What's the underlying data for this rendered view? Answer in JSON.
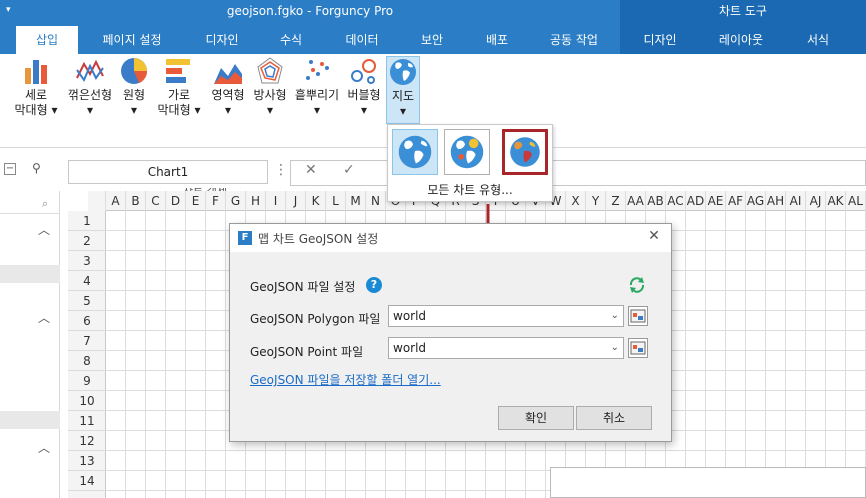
{
  "window": {
    "title": "geojson.fgko - Forguncy Pro",
    "context_title": "차트 도구"
  },
  "tabs": [
    {
      "label": "삽입",
      "active": true
    },
    {
      "label": "페이지 설정"
    },
    {
      "label": "디자인"
    },
    {
      "label": "수식"
    },
    {
      "label": "데이터"
    },
    {
      "label": "보안"
    },
    {
      "label": "배포"
    },
    {
      "label": "공동 작업"
    },
    {
      "label": "디자인"
    },
    {
      "label": "레이아웃"
    },
    {
      "label": "서식"
    }
  ],
  "ribbon": {
    "buttons": [
      {
        "line1": "세로",
        "line2": "막대형 ▾"
      },
      {
        "line1": "꺾은선형",
        "line2": "▾"
      },
      {
        "line1": "원형",
        "line2": "▾"
      },
      {
        "line1": "가로",
        "line2": "막대형 ▾"
      },
      {
        "line1": "영역형",
        "line2": "▾"
      },
      {
        "line1": "방사형",
        "line2": "▾"
      },
      {
        "line1": "흩뿌리기",
        "line2": "▾"
      },
      {
        "line1": "버블형",
        "line2": "▾"
      },
      {
        "line1": "지도",
        "line2": "▾"
      }
    ],
    "group_label": "차트 객체"
  },
  "formula_bar": {
    "name_box": "Chart1"
  },
  "columns": [
    "A",
    "B",
    "C",
    "D",
    "E",
    "F",
    "G",
    "H",
    "I",
    "J",
    "K",
    "L",
    "M",
    "N",
    "O",
    "P",
    "Q",
    "R",
    "S",
    "T",
    "U",
    "V",
    "W",
    "X",
    "Y",
    "Z",
    "AA",
    "AB",
    "AC",
    "AD",
    "AE",
    "AF",
    "AG",
    "AH",
    "AI",
    "AJ",
    "AK",
    "AL"
  ],
  "rows": [
    "1",
    "2",
    "3",
    "4",
    "5",
    "6",
    "7",
    "8",
    "9",
    "10",
    "11",
    "12",
    "13",
    "14"
  ],
  "dropdown": {
    "all_types": "모든 차트 유형..."
  },
  "dialog": {
    "title": "맵 차트 GeoJSON 설정",
    "header_label": "GeoJSON 파일 설정",
    "polygon_label": "GeoJSON Polygon 파일",
    "polygon_value": "world",
    "point_label": "GeoJSON Point 파일",
    "point_value": "world",
    "link": "GeoJSON 파일을 저장할 폴더 열기...",
    "ok": "확인",
    "cancel": "취소"
  },
  "colors": {
    "accent": "#2b7dc5",
    "context": "#1a69b2",
    "highlight": "#a8262a"
  }
}
